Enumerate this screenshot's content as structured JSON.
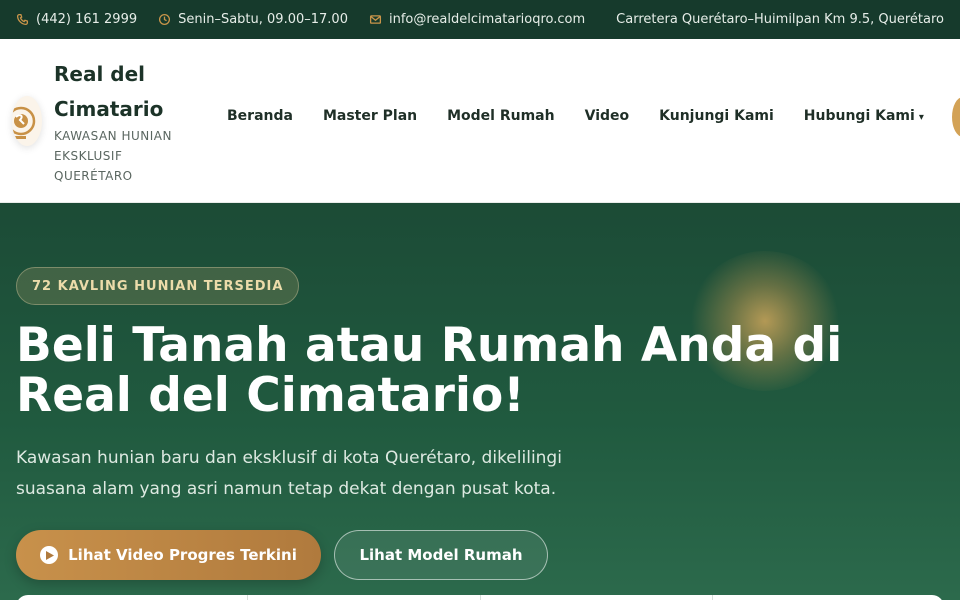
{
  "topbar": {
    "phone": "(442) 161 2999",
    "hours": "Senin–Sabtu, 09.00–17.00",
    "email": "info@realdelcimatarioqro.com",
    "address": "Carretera Querétaro–Huimilpan Km 9.5, Querétaro"
  },
  "brand": {
    "name": "Real del Cimatario",
    "tagline": "KAWASAN HUNIAN EKSKLUSIF QUERÉTARO"
  },
  "nav": {
    "items": [
      {
        "label": "Beranda"
      },
      {
        "label": "Master Plan"
      },
      {
        "label": "Model Rumah"
      },
      {
        "label": "Video"
      },
      {
        "label": "Kunjungi Kami"
      },
      {
        "label": "Hubungi Kami"
      }
    ],
    "dropdown_caret": "▾"
  },
  "hero": {
    "badge": "72 KAVLING HUNIAN TERSEDIA",
    "title": "Beli Tanah atau Rumah Anda di Real del Cimatario!",
    "subtitle": "Kawasan hunian baru dan eksklusif di kota Querétaro, dikelilingi suasana alam yang asri namun tetap dekat dengan pusat kota.",
    "primary_button": "Lihat Video Progres Terkini",
    "secondary_button": "Lihat Model Rumah"
  },
  "icons": {
    "phone": "phone-icon",
    "hours": "clock-icon",
    "email": "mail-icon",
    "play": "play-icon"
  },
  "colors": {
    "topbar_bg": "#163a2c",
    "hero_green": "#205a3f",
    "accent_gold": "#c8914b",
    "text_dark": "#1f2f27"
  }
}
